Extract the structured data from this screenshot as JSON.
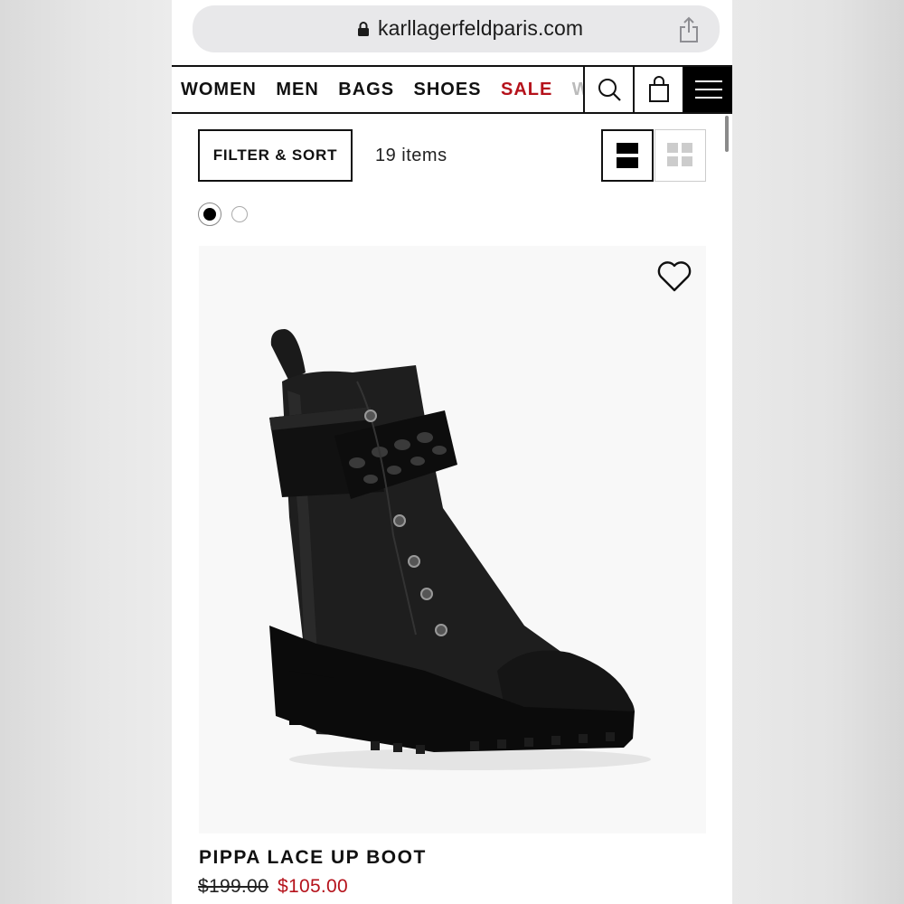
{
  "browser": {
    "url": "karllagerfeldparis.com",
    "lock_icon": "lock-icon",
    "share_icon": "share-icon"
  },
  "nav": {
    "items": [
      {
        "label": "WOMEN"
      },
      {
        "label": "MEN"
      },
      {
        "label": "BAGS"
      },
      {
        "label": "SHOES"
      },
      {
        "label": "SALE",
        "color": "#b5121b"
      },
      {
        "label": "W"
      }
    ],
    "search_icon": "search-icon",
    "bag_icon": "shopping-bag-icon",
    "menu_icon": "hamburger-menu-icon"
  },
  "toolbar": {
    "filter_label": "FILTER & SORT",
    "items_count": "19 items",
    "view_single_icon": "single-column-view-icon",
    "view_grid_icon": "grid-view-icon"
  },
  "swatches": [
    {
      "color": "#000000",
      "selected": true
    },
    {
      "color": "#ffffff",
      "selected": false
    }
  ],
  "product": {
    "name": "PIPPA LACE UP BOOT",
    "original_price": "$199.00",
    "sale_price": "$105.00",
    "wishlist_icon": "heart-icon",
    "image": "black-leather-lace-up-boot-with-jeweled-strap"
  },
  "colors": {
    "sale_red": "#b5121b",
    "text": "#111111"
  }
}
